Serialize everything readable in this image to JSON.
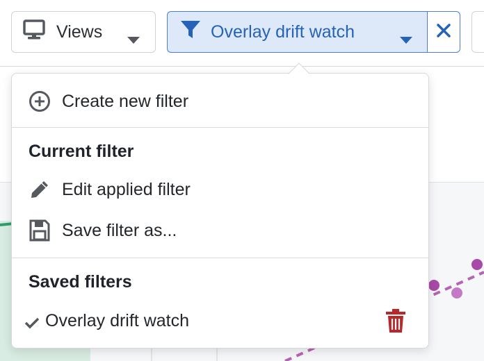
{
  "toolbar": {
    "views_label": "Views",
    "views_icon": "monitor-icon",
    "active_filter_label": "Overlay drift watch",
    "filter_icon": "filter-funnel-icon",
    "clear_icon": "close-icon"
  },
  "menu": {
    "create_label": "Create new filter",
    "current_section_title": "Current filter",
    "edit_label": "Edit applied filter",
    "save_as_label": "Save filter as...",
    "saved_section_title": "Saved filters",
    "saved_filters": [
      {
        "label": "Overlay drift watch",
        "selected": true
      }
    ]
  },
  "colors": {
    "accent": "#2563b8",
    "active_bg": "#dde9f8",
    "delete": "#b8282a",
    "series_purple": "#a84aa8",
    "series_green": "#2e9e6a"
  }
}
